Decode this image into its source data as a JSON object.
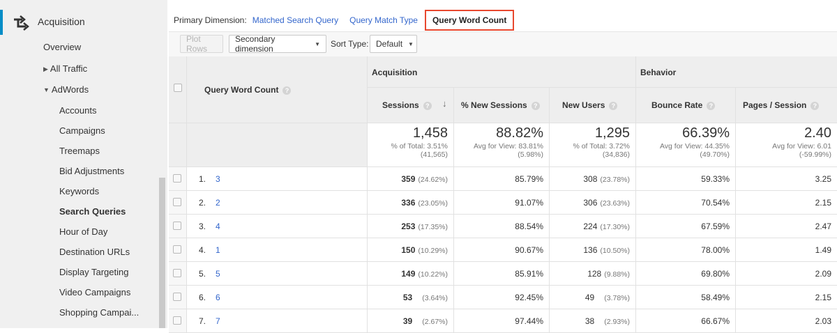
{
  "sidebar": {
    "section_label": "Acquisition",
    "items": [
      {
        "label": "Overview"
      },
      {
        "label": "All Traffic"
      },
      {
        "label": "AdWords"
      },
      {
        "label": "Accounts"
      },
      {
        "label": "Campaigns"
      },
      {
        "label": "Treemaps"
      },
      {
        "label": "Bid Adjustments"
      },
      {
        "label": "Keywords"
      },
      {
        "label": "Search Queries"
      },
      {
        "label": "Hour of Day"
      },
      {
        "label": "Destination URLs"
      },
      {
        "label": "Display Targeting"
      },
      {
        "label": "Video Campaigns"
      },
      {
        "label": "Shopping Campai..."
      }
    ]
  },
  "dimension": {
    "label": "Primary Dimension:",
    "options": [
      "Matched Search Query",
      "Query Match Type",
      "Query Word Count"
    ],
    "selected": "Query Word Count"
  },
  "toolbar": {
    "plot_rows": "Plot Rows",
    "secondary_dimension": "Secondary dimension",
    "sort_type_label": "Sort Type:",
    "sort_type_value": "Default"
  },
  "table": {
    "dimension_header": "Query Word Count",
    "group_acquisition": "Acquisition",
    "group_behavior": "Behavior",
    "columns": [
      "Sessions",
      "% New Sessions",
      "New Users",
      "Bounce Rate",
      "Pages / Session"
    ],
    "totals": [
      {
        "value": "1,458",
        "sub1": "% of Total: 3.51%",
        "sub2": "(41,565)"
      },
      {
        "value": "88.82%",
        "sub1": "Avg for View: 83.81%",
        "sub2": "(5.98%)"
      },
      {
        "value": "1,295",
        "sub1": "% of Total: 3.72%",
        "sub2": "(34,836)"
      },
      {
        "value": "66.39%",
        "sub1": "Avg for View: 44.35%",
        "sub2": "(49.70%)"
      },
      {
        "value": "2.40",
        "sub1": "Avg for View: 6.01",
        "sub2": "(-59.99%)"
      }
    ],
    "rows": [
      {
        "num": "1.",
        "dim": "3",
        "sessions": "359",
        "sessions_pct": "(24.62%)",
        "new_sessions": "85.79%",
        "new_users": "308",
        "new_users_pct": "(23.78%)",
        "bounce": "59.33%",
        "pages": "3.25"
      },
      {
        "num": "2.",
        "dim": "2",
        "sessions": "336",
        "sessions_pct": "(23.05%)",
        "new_sessions": "91.07%",
        "new_users": "306",
        "new_users_pct": "(23.63%)",
        "bounce": "70.54%",
        "pages": "2.15"
      },
      {
        "num": "3.",
        "dim": "4",
        "sessions": "253",
        "sessions_pct": "(17.35%)",
        "new_sessions": "88.54%",
        "new_users": "224",
        "new_users_pct": "(17.30%)",
        "bounce": "67.59%",
        "pages": "2.47"
      },
      {
        "num": "4.",
        "dim": "1",
        "sessions": "150",
        "sessions_pct": "(10.29%)",
        "new_sessions": "90.67%",
        "new_users": "136",
        "new_users_pct": "(10.50%)",
        "bounce": "78.00%",
        "pages": "1.49"
      },
      {
        "num": "5.",
        "dim": "5",
        "sessions": "149",
        "sessions_pct": "(10.22%)",
        "new_sessions": "85.91%",
        "new_users": "128",
        "new_users_pct": "(9.88%)",
        "bounce": "69.80%",
        "pages": "2.09"
      },
      {
        "num": "6.",
        "dim": "6",
        "sessions": "53",
        "sessions_pct": "(3.64%)",
        "new_sessions": "92.45%",
        "new_users": "49",
        "new_users_pct": "(3.78%)",
        "bounce": "58.49%",
        "pages": "2.15"
      },
      {
        "num": "7.",
        "dim": "7",
        "sessions": "39",
        "sessions_pct": "(2.67%)",
        "new_sessions": "97.44%",
        "new_users": "38",
        "new_users_pct": "(2.93%)",
        "bounce": "66.67%",
        "pages": "2.03"
      }
    ]
  },
  "colors": {
    "link": "#3366cc",
    "active_border": "#e8482f",
    "active_bar": "#058dc7"
  }
}
